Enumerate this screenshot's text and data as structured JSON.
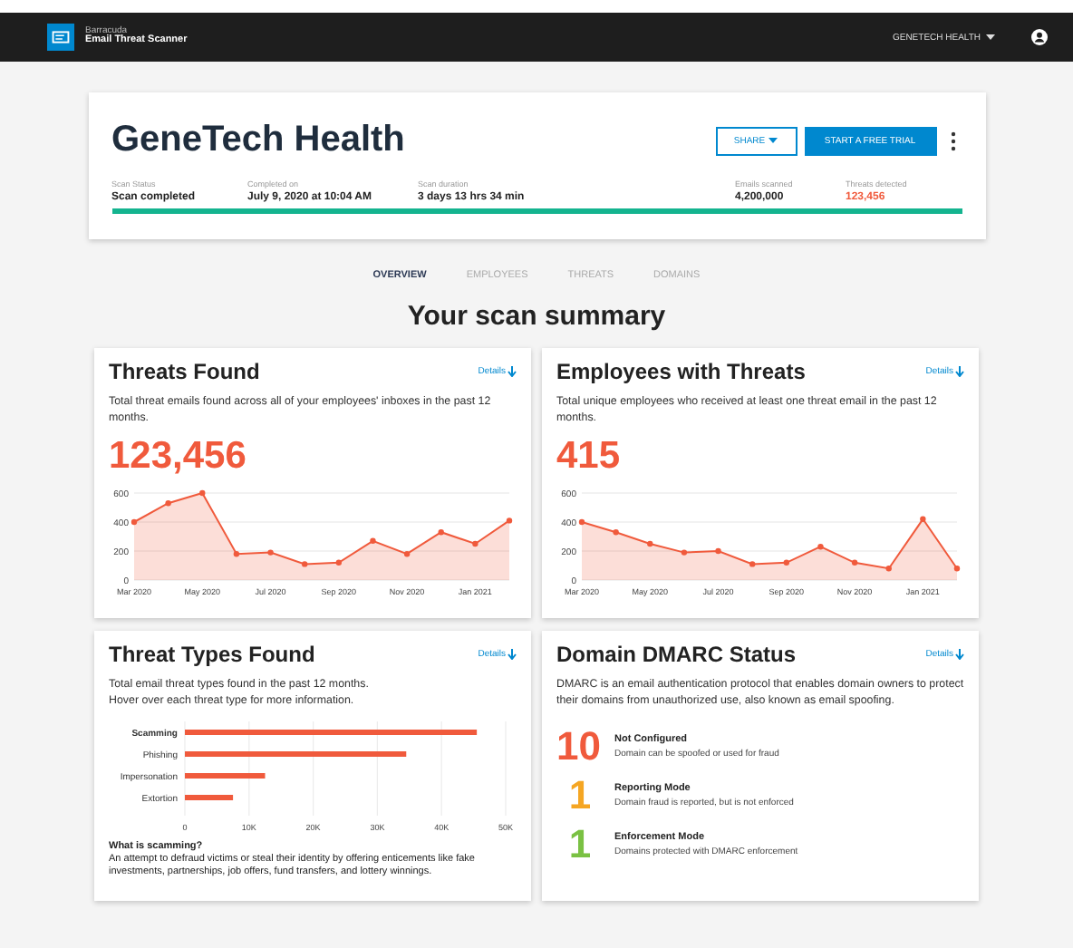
{
  "app_bar": {
    "brand": "Barracuda",
    "product": "Email Threat Scanner",
    "account": "GENETECH HEALTH"
  },
  "header": {
    "title": "GeneTech Health",
    "share": "SHARE",
    "trial": "START A FREE TRIAL",
    "stats": [
      {
        "label": "Scan Status",
        "value": "Scan completed",
        "kind": "plain"
      },
      {
        "label": "Completed on",
        "value": "July 9, 2020 at 10:04 AM",
        "kind": "plain"
      },
      {
        "label": "Scan duration",
        "value": "3 days 13 hrs 34 min",
        "kind": "plain"
      },
      {
        "label": "Emails scanned",
        "value": "4,200,000",
        "kind": "plain"
      },
      {
        "label": "Threats detected",
        "value": "123,456",
        "kind": "alert"
      }
    ],
    "progress": {
      "level": 1
    }
  },
  "tabs": [
    {
      "label": "OVERVIEW",
      "selected": true
    },
    {
      "label": "EMPLOYEES",
      "selected": false
    },
    {
      "label": "THREATS",
      "selected": false
    },
    {
      "label": "DOMAINS",
      "selected": false
    }
  ],
  "heading": "Your scan summary",
  "cards": [
    {
      "kind": "line",
      "title": "Threats Found",
      "details": "Details",
      "description": "Total threat emails found across all of your employees' inboxes in the past 12 months.",
      "total": "123,456",
      "chart_data": {
        "type": "area",
        "categories": [
          "Mar 2020",
          null,
          "May 2020",
          null,
          "Jul 2020",
          null,
          "Sep 2020",
          null,
          "Nov 2020",
          null,
          "Jan 2021",
          null
        ],
        "yticks": [
          0,
          200,
          400,
          600
        ],
        "ylim": [
          0,
          600
        ],
        "grid": true,
        "series": [
          {
            "color": "#f05a3c",
            "values": [
              400,
              530,
              600,
              180,
              190,
              110,
              120,
              270,
              180,
              330,
              250,
              410
            ]
          }
        ]
      }
    },
    {
      "kind": "line",
      "title": "Employees with Threats",
      "details": "Details",
      "description": "Total unique employees who received at least one threat email in the past 12 months.",
      "total": "415",
      "chart_data": {
        "type": "area",
        "categories": [
          "Mar 2020",
          null,
          "May 2020",
          null,
          "Jul 2020",
          null,
          "Sep 2020",
          null,
          "Nov 2020",
          null,
          "Jan 2021",
          null
        ],
        "yticks": [
          0,
          200,
          400,
          600
        ],
        "ylim": [
          0,
          600
        ],
        "grid": true,
        "series": [
          {
            "color": "#f05a3c",
            "values": [
              400,
              330,
              250,
              190,
              200,
              110,
              120,
              230,
              120,
              80,
              420,
              80
            ]
          }
        ]
      }
    },
    {
      "kind": "bars",
      "title": "Threat Types Found",
      "details": "Details",
      "description": "Total email threat types found in the past 12 months.",
      "hint": "Hover over each threat type for more information.",
      "chart_data": {
        "type": "bar",
        "orientation": "horizontal",
        "grid": true,
        "categories": [
          "Scamming",
          "Phishing",
          "Impersonation",
          "Extortion"
        ],
        "xlim": [
          0,
          50000
        ],
        "xticks": [
          {
            "value": 0,
            "label": "0"
          },
          {
            "value": 10000,
            "label": "10K"
          },
          {
            "value": 20000,
            "label": "20K"
          },
          {
            "value": 30000,
            "label": "30K"
          },
          {
            "value": 40000,
            "label": "40K"
          },
          {
            "value": 50000,
            "label": "50K"
          }
        ],
        "series": [
          {
            "color": "#f05a3c",
            "values": [
              45500,
              34500,
              12500,
              7500
            ]
          }
        ]
      },
      "note_title": "What is scamming?",
      "note": "An attempt to defraud victims or steal their identity by offering enticements like fake investments, partnerships, job offers, fund transfers, and lottery winnings."
    },
    {
      "kind": "dmarc",
      "title": "Domain DMARC Status",
      "details": "Details",
      "description": "DMARC is an email authentication protocol that enables domain owners to protect their domains from unauthorized use, also known as email spoofing.",
      "statuses": [
        {
          "count": "10",
          "label": "Not Configured",
          "text": "Domain can be spoofed or used for fraud",
          "color": "#f05a3c"
        },
        {
          "count": "1",
          "label": "Reporting Mode",
          "text": "Domain fraud is reported, but is not enforced",
          "color": "#f5a623"
        },
        {
          "count": "1",
          "label": "Enforcement Mode",
          "text": "Domains protected with DMARC enforcement",
          "color": "#7ac143"
        }
      ]
    }
  ]
}
